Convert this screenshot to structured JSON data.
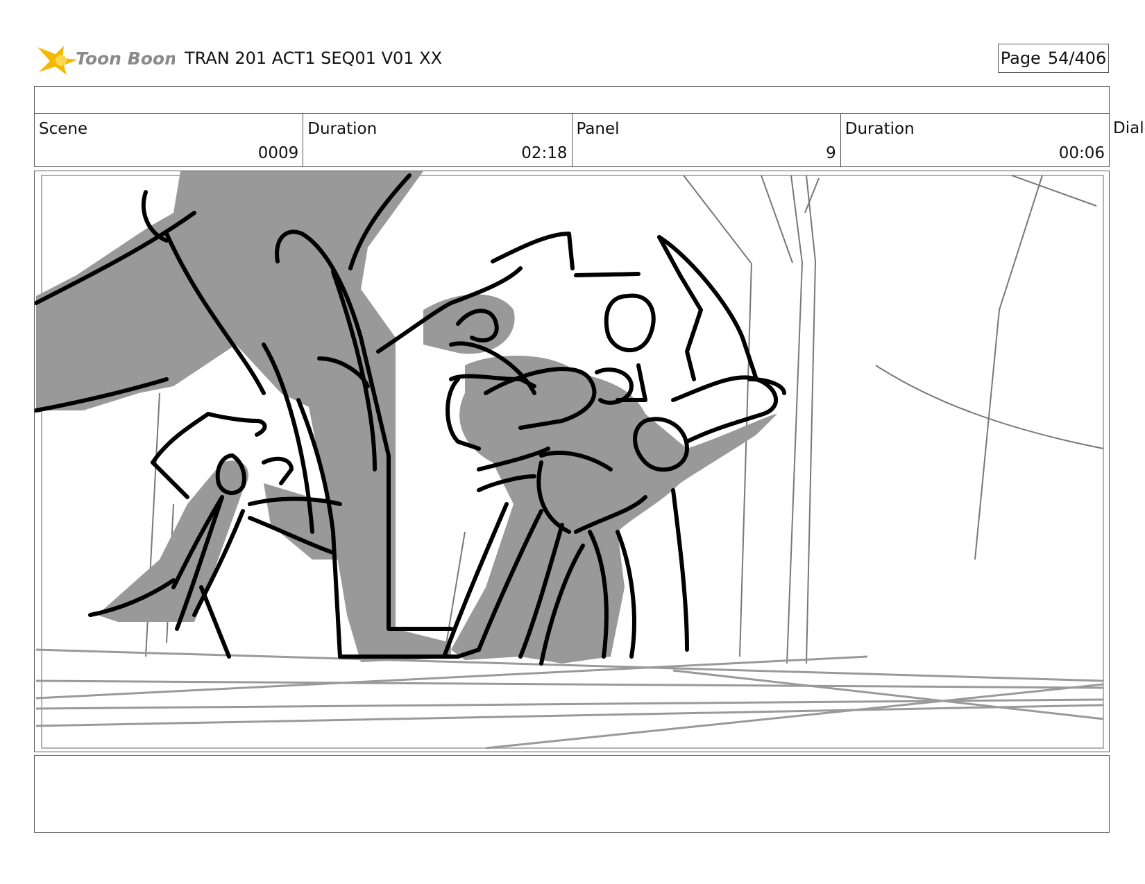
{
  "header": {
    "logo_text": "Toon Boom",
    "title": "TRAN 201 ACT1 SEQ01 V01 XX",
    "page_label": "Page",
    "page_value": "54/406"
  },
  "info": {
    "scene_label": "Scene",
    "scene_value": "0009",
    "scene_duration_label": "Duration",
    "scene_duration_value": "02:18",
    "panel_label": "Panel",
    "panel_value": "9",
    "panel_duration_label": "Duration",
    "panel_duration_value": "00:06",
    "dialog_label": "Dialog"
  },
  "colors": {
    "logo_star": "#f5b800",
    "logo_text": "#8a8a8a",
    "sketch_ink": "#000000",
    "sketch_fill": "#999999",
    "sketch_line": "#777777"
  }
}
